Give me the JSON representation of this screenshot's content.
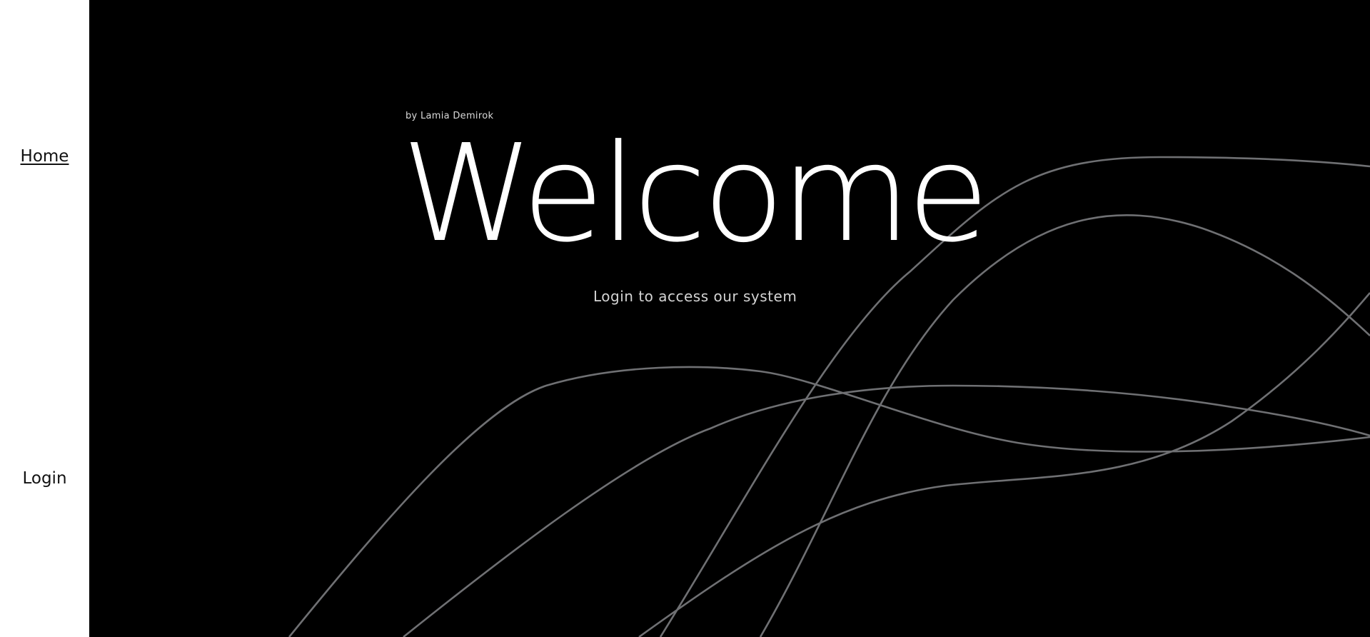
{
  "nav": {
    "home_label": "Home",
    "login_label": "Login"
  },
  "hero": {
    "author": "by Lamia Demirok",
    "title": "Welcome",
    "subtitle": "Login to access our system",
    "background_color": "#000000",
    "line_color": "#6f7073"
  }
}
